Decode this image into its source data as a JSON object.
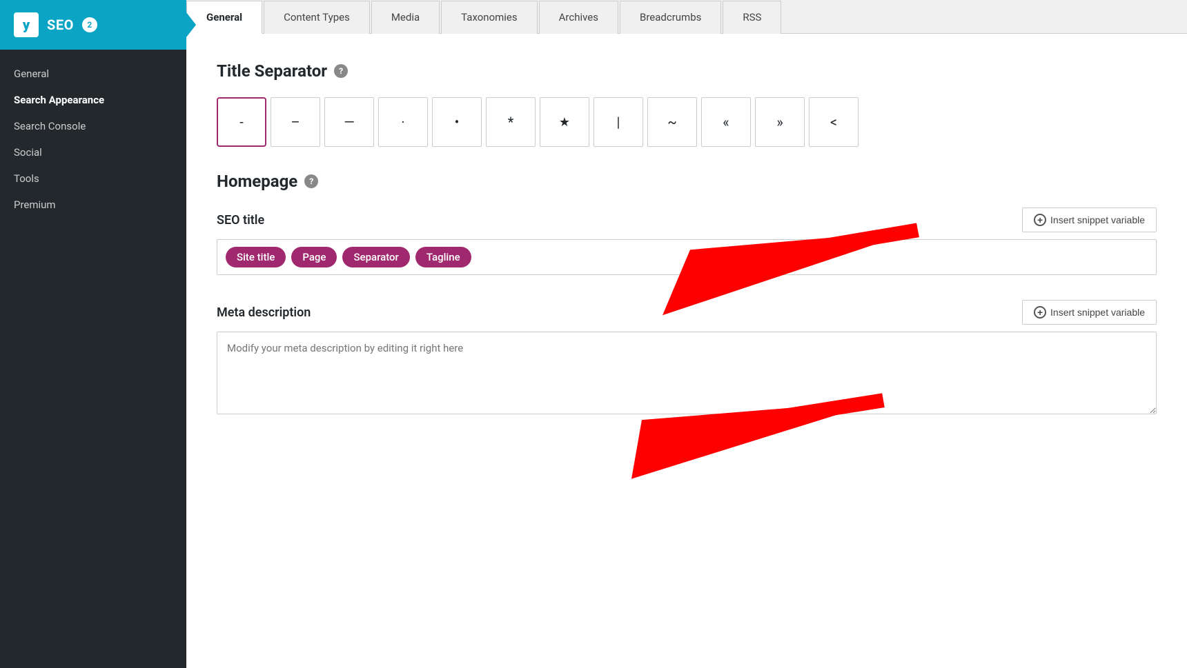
{
  "sidebar": {
    "logo_text": "y",
    "title": "SEO",
    "badge": "2",
    "nav_items": [
      {
        "label": "General",
        "active": false
      },
      {
        "label": "Search Appearance",
        "active": true
      },
      {
        "label": "Search Console",
        "active": false
      },
      {
        "label": "Social",
        "active": false
      },
      {
        "label": "Tools",
        "active": false
      },
      {
        "label": "Premium",
        "active": false
      }
    ]
  },
  "tabs": [
    {
      "label": "General",
      "active": true
    },
    {
      "label": "Content Types",
      "active": false
    },
    {
      "label": "Media",
      "active": false
    },
    {
      "label": "Taxonomies",
      "active": false
    },
    {
      "label": "Archives",
      "active": false
    },
    {
      "label": "Breadcrumbs",
      "active": false
    },
    {
      "label": "RSS",
      "active": false
    }
  ],
  "title_separator": {
    "heading": "Title Separator",
    "separators": [
      "-",
      "–",
      "—",
      "·",
      "•",
      "*",
      "★",
      "|",
      "~",
      "«",
      "»",
      "<"
    ]
  },
  "homepage": {
    "heading": "Homepage",
    "seo_title_label": "SEO title",
    "insert_snippet_label": "Insert snippet variable",
    "tags": [
      "Site title",
      "Page",
      "Separator",
      "Tagline"
    ],
    "meta_description_label": "Meta description",
    "meta_description_placeholder": "Modify your meta description by editing it right here"
  }
}
